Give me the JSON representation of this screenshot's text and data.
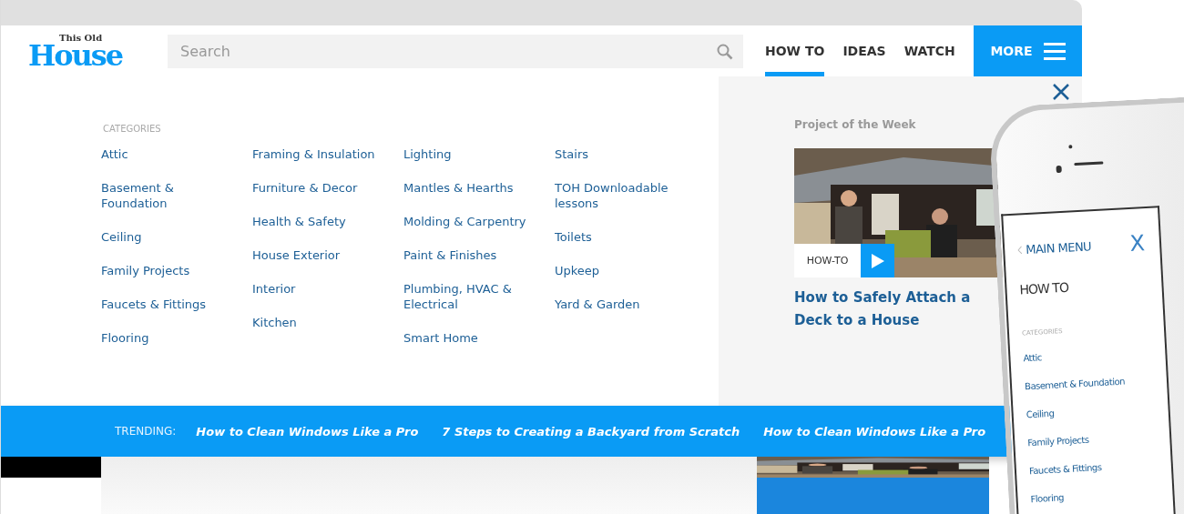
{
  "logo": {
    "small": "This Old",
    "large": "House"
  },
  "search": {
    "placeholder": "Search"
  },
  "nav": [
    {
      "label": "HOW TO",
      "selected": true
    },
    {
      "label": "IDEAS",
      "selected": false
    },
    {
      "label": "WATCH",
      "selected": false
    }
  ],
  "more_button": {
    "label": "MORE"
  },
  "menu": {
    "heading": "CATEGORIES",
    "columns": [
      [
        "Attic",
        "Basement & Foundation",
        "Ceiling",
        "Family Projects",
        "Faucets & Fittings",
        "Flooring"
      ],
      [
        "Framing & Insulation",
        "Furniture & Decor",
        "Health & Safety",
        "House Exterior",
        "Interior",
        "Kitchen"
      ],
      [
        "Lighting",
        "Mantles & Hearths",
        "Molding & Carpentry",
        "Paint & Finishes",
        "Plumbing, HVAC & Electrical",
        "Smart Home"
      ],
      [
        "Stairs",
        "TOH Downloadable lessons",
        "Toilets",
        "Upkeep",
        "Yard & Garden"
      ]
    ]
  },
  "project": {
    "heading": "Project of the Week",
    "tag": "HOW-TO",
    "title": "How to Safely Attach a Deck to a House"
  },
  "trending": {
    "label": "TRENDING:",
    "links": [
      "How to Clean Windows Like a Pro",
      "7 Steps to Creating a Backyard from Scratch",
      "How to Clean Windows Like a Pro"
    ]
  },
  "phone": {
    "back": "MAIN MENU",
    "close": "X",
    "title": "HOW TO",
    "heading": "CATEGORIES",
    "items": [
      "Attic",
      "Basement & Foundation",
      "Ceiling",
      "Family Projects",
      "Faucets & Fittings",
      "Flooring"
    ]
  }
}
